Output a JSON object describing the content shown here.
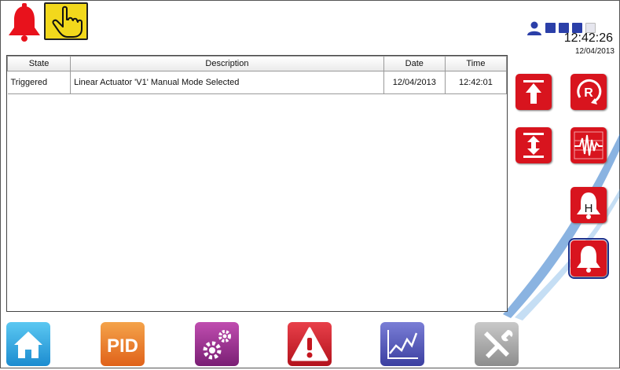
{
  "colors": {
    "accent_red": "#d8141e",
    "hand_yellow": "#f2d81c",
    "level_blue": "#2b3fa8"
  },
  "header": {
    "icons": [
      "alarm-bell-icon",
      "hand-manual-icon"
    ],
    "user_level": {
      "icon": "user-icon",
      "filled": 3,
      "total": 4
    },
    "time": "12:42:26",
    "date": "12/04/2013"
  },
  "table": {
    "columns": [
      "State",
      "Description",
      "Date",
      "Time"
    ],
    "rows": [
      {
        "state": "Triggered",
        "description": "Linear Actuator 'V1' Manual Mode Selected",
        "date": "12/04/2013",
        "time": "12:42:01"
      }
    ]
  },
  "side_buttons": [
    "actuator-extend-icon",
    "reset-icon",
    "actuator-range-icon",
    "trend-signal-icon",
    "alarm-hold-icon",
    "alarm-active-icon"
  ],
  "side_hold_letter": "H",
  "side_reset_letter": "R",
  "nav": [
    "home-icon",
    "pid-icon",
    "settings-icon",
    "alarms-icon",
    "trends-icon",
    "tools-icon"
  ],
  "nav_pid_label": "PID"
}
